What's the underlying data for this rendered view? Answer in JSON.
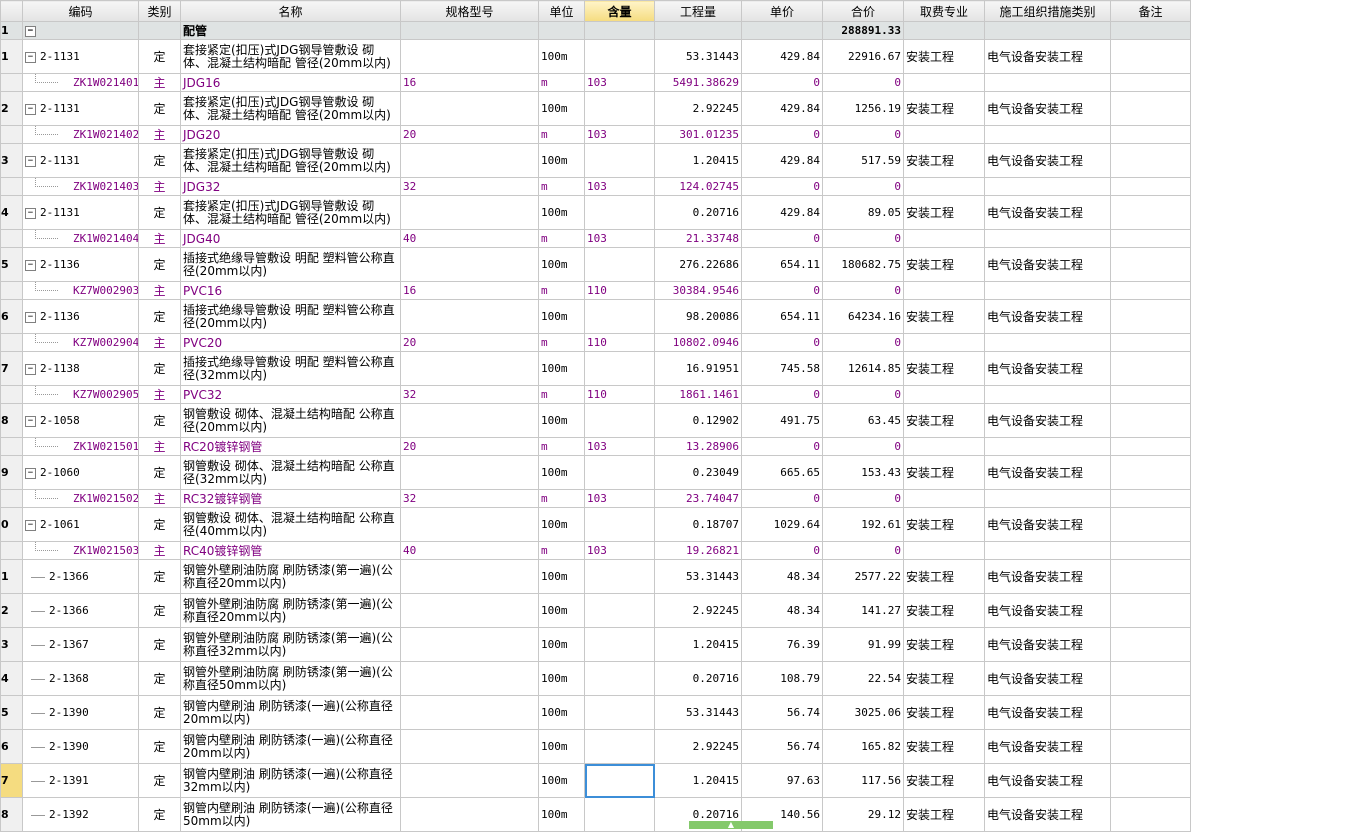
{
  "headers": [
    "编码",
    "类别",
    "名称",
    "规格型号",
    "单位",
    "含量",
    "工程量",
    "单价",
    "合价",
    "取费专业",
    "施工组织措施类别",
    "备注"
  ],
  "group": {
    "rownum": "1",
    "toggle": "−",
    "name": "配管",
    "total": "288891.33"
  },
  "rows": [
    {
      "type": "qd",
      "rn": "1",
      "toggle": "−",
      "code": "2-1131",
      "cat": "定",
      "name": "套接紧定(扣压)式JDG钢导管敷设 砌体、混凝土结构暗配 管径(20mm以内)",
      "spec": "",
      "unit": "100m",
      "content": "",
      "qty": "53.31443",
      "price": "429.84",
      "total": "22916.67",
      "fee": "安装工程",
      "measure": "电气设备安装工程",
      "note": ""
    },
    {
      "type": "sub",
      "rn": "",
      "code": "ZK1W021401",
      "cat": "主",
      "name": "JDG16",
      "spec": "16",
      "unit": "m",
      "content": "103",
      "qty": "5491.38629",
      "price": "0",
      "total": "0",
      "fee": "",
      "measure": "",
      "note": ""
    },
    {
      "type": "qd",
      "rn": "2",
      "toggle": "−",
      "code": "2-1131",
      "cat": "定",
      "name": "套接紧定(扣压)式JDG钢导管敷设 砌体、混凝土结构暗配 管径(20mm以内)",
      "spec": "",
      "unit": "100m",
      "content": "",
      "qty": "2.92245",
      "price": "429.84",
      "total": "1256.19",
      "fee": "安装工程",
      "measure": "电气设备安装工程",
      "note": ""
    },
    {
      "type": "sub",
      "rn": "",
      "code": "ZK1W021402",
      "cat": "主",
      "name": "JDG20",
      "spec": "20",
      "unit": "m",
      "content": "103",
      "qty": "301.01235",
      "price": "0",
      "total": "0",
      "fee": "",
      "measure": "",
      "note": ""
    },
    {
      "type": "qd",
      "rn": "3",
      "toggle": "−",
      "code": "2-1131",
      "cat": "定",
      "name": "套接紧定(扣压)式JDG钢导管敷设 砌体、混凝土结构暗配 管径(20mm以内)",
      "spec": "",
      "unit": "100m",
      "content": "",
      "qty": "1.20415",
      "price": "429.84",
      "total": "517.59",
      "fee": "安装工程",
      "measure": "电气设备安装工程",
      "note": ""
    },
    {
      "type": "sub",
      "rn": "",
      "code": "ZK1W021403",
      "cat": "主",
      "name": "JDG32",
      "spec": "32",
      "unit": "m",
      "content": "103",
      "qty": "124.02745",
      "price": "0",
      "total": "0",
      "fee": "",
      "measure": "",
      "note": ""
    },
    {
      "type": "qd",
      "rn": "4",
      "toggle": "−",
      "code": "2-1131",
      "cat": "定",
      "name": "套接紧定(扣压)式JDG钢导管敷设 砌体、混凝土结构暗配 管径(20mm以内)",
      "spec": "",
      "unit": "100m",
      "content": "",
      "qty": "0.20716",
      "price": "429.84",
      "total": "89.05",
      "fee": "安装工程",
      "measure": "电气设备安装工程",
      "note": ""
    },
    {
      "type": "sub",
      "rn": "",
      "code": "ZK1W021404",
      "cat": "主",
      "name": "JDG40",
      "spec": "40",
      "unit": "m",
      "content": "103",
      "qty": "21.33748",
      "price": "0",
      "total": "0",
      "fee": "",
      "measure": "",
      "note": ""
    },
    {
      "type": "qd",
      "rn": "5",
      "toggle": "−",
      "code": "2-1136",
      "cat": "定",
      "name": "插接式绝缘导管敷设 明配 塑料管公称直径(20mm以内)",
      "spec": "",
      "unit": "100m",
      "content": "",
      "qty": "276.22686",
      "price": "654.11",
      "total": "180682.75",
      "fee": "安装工程",
      "measure": "电气设备安装工程",
      "note": ""
    },
    {
      "type": "sub",
      "rn": "",
      "code": "KZ7W002903",
      "cat": "主",
      "name": "PVC16",
      "spec": "16",
      "unit": "m",
      "content": "110",
      "qty": "30384.9546",
      "price": "0",
      "total": "0",
      "fee": "",
      "measure": "",
      "note": ""
    },
    {
      "type": "qd",
      "rn": "6",
      "toggle": "−",
      "code": "2-1136",
      "cat": "定",
      "name": "插接式绝缘导管敷设 明配 塑料管公称直径(20mm以内)",
      "spec": "",
      "unit": "100m",
      "content": "",
      "qty": "98.20086",
      "price": "654.11",
      "total": "64234.16",
      "fee": "安装工程",
      "measure": "电气设备安装工程",
      "note": ""
    },
    {
      "type": "sub",
      "rn": "",
      "code": "KZ7W002904",
      "cat": "主",
      "name": "PVC20",
      "spec": "20",
      "unit": "m",
      "content": "110",
      "qty": "10802.0946",
      "price": "0",
      "total": "0",
      "fee": "",
      "measure": "",
      "note": ""
    },
    {
      "type": "qd",
      "rn": "7",
      "toggle": "−",
      "code": "2-1138",
      "cat": "定",
      "name": "插接式绝缘导管敷设 明配 塑料管公称直径(32mm以内)",
      "spec": "",
      "unit": "100m",
      "content": "",
      "qty": "16.91951",
      "price": "745.58",
      "total": "12614.85",
      "fee": "安装工程",
      "measure": "电气设备安装工程",
      "note": ""
    },
    {
      "type": "sub",
      "rn": "",
      "code": "KZ7W002905",
      "cat": "主",
      "name": "PVC32",
      "spec": "32",
      "unit": "m",
      "content": "110",
      "qty": "1861.1461",
      "price": "0",
      "total": "0",
      "fee": "",
      "measure": "",
      "note": ""
    },
    {
      "type": "qd",
      "rn": "8",
      "toggle": "−",
      "code": "2-1058",
      "cat": "定",
      "name": "钢管敷设 砌体、混凝土结构暗配 公称直径(20mm以内)",
      "spec": "",
      "unit": "100m",
      "content": "",
      "qty": "0.12902",
      "price": "491.75",
      "total": "63.45",
      "fee": "安装工程",
      "measure": "电气设备安装工程",
      "note": ""
    },
    {
      "type": "sub",
      "rn": "",
      "code": "ZK1W021501",
      "cat": "主",
      "name": "RC20镀锌钢管",
      "spec": "20",
      "unit": "m",
      "content": "103",
      "qty": "13.28906",
      "price": "0",
      "total": "0",
      "fee": "",
      "measure": "",
      "note": ""
    },
    {
      "type": "qd",
      "rn": "9",
      "toggle": "−",
      "code": "2-1060",
      "cat": "定",
      "name": "钢管敷设 砌体、混凝土结构暗配 公称直径(32mm以内)",
      "spec": "",
      "unit": "100m",
      "content": "",
      "qty": "0.23049",
      "price": "665.65",
      "total": "153.43",
      "fee": "安装工程",
      "measure": "电气设备安装工程",
      "note": ""
    },
    {
      "type": "sub",
      "rn": "",
      "code": "ZK1W021502",
      "cat": "主",
      "name": "RC32镀锌钢管",
      "spec": "32",
      "unit": "m",
      "content": "103",
      "qty": "23.74047",
      "price": "0",
      "total": "0",
      "fee": "",
      "measure": "",
      "note": ""
    },
    {
      "type": "qd",
      "rn": "0",
      "toggle": "−",
      "code": "2-1061",
      "cat": "定",
      "name": "钢管敷设 砌体、混凝土结构暗配 公称直径(40mm以内)",
      "spec": "",
      "unit": "100m",
      "content": "",
      "qty": "0.18707",
      "price": "1029.64",
      "total": "192.61",
      "fee": "安装工程",
      "measure": "电气设备安装工程",
      "note": ""
    },
    {
      "type": "sub",
      "rn": "",
      "code": "ZK1W021503",
      "cat": "主",
      "name": "RC40镀锌钢管",
      "spec": "40",
      "unit": "m",
      "content": "103",
      "qty": "19.26821",
      "price": "0",
      "total": "0",
      "fee": "",
      "measure": "",
      "note": ""
    },
    {
      "type": "qd",
      "rn": "1",
      "toggle": "",
      "code": "2-1366",
      "cat": "定",
      "name": "钢管外壁刷油防腐 刷防锈漆(第一遍)(公称直径20mm以内)",
      "spec": "",
      "unit": "100m",
      "content": "",
      "qty": "53.31443",
      "price": "48.34",
      "total": "2577.22",
      "fee": "安装工程",
      "measure": "电气设备安装工程",
      "note": ""
    },
    {
      "type": "qd",
      "rn": "2",
      "toggle": "",
      "code": "2-1366",
      "cat": "定",
      "name": "钢管外壁刷油防腐 刷防锈漆(第一遍)(公称直径20mm以内)",
      "spec": "",
      "unit": "100m",
      "content": "",
      "qty": "2.92245",
      "price": "48.34",
      "total": "141.27",
      "fee": "安装工程",
      "measure": "电气设备安装工程",
      "note": ""
    },
    {
      "type": "qd",
      "rn": "3",
      "toggle": "",
      "code": "2-1367",
      "cat": "定",
      "name": "钢管外壁刷油防腐 刷防锈漆(第一遍)(公称直径32mm以内)",
      "spec": "",
      "unit": "100m",
      "content": "",
      "qty": "1.20415",
      "price": "76.39",
      "total": "91.99",
      "fee": "安装工程",
      "measure": "电气设备安装工程",
      "note": ""
    },
    {
      "type": "qd",
      "rn": "4",
      "toggle": "",
      "code": "2-1368",
      "cat": "定",
      "name": "钢管外壁刷油防腐 刷防锈漆(第一遍)(公称直径50mm以内)",
      "spec": "",
      "unit": "100m",
      "content": "",
      "qty": "0.20716",
      "price": "108.79",
      "total": "22.54",
      "fee": "安装工程",
      "measure": "电气设备安装工程",
      "note": ""
    },
    {
      "type": "qd",
      "rn": "5",
      "toggle": "",
      "code": "2-1390",
      "cat": "定",
      "name": "钢管内壁刷油 刷防锈漆(一遍)(公称直径20mm以内)",
      "spec": "",
      "unit": "100m",
      "content": "",
      "qty": "53.31443",
      "price": "56.74",
      "total": "3025.06",
      "fee": "安装工程",
      "measure": "电气设备安装工程",
      "note": ""
    },
    {
      "type": "qd",
      "rn": "6",
      "toggle": "",
      "code": "2-1390",
      "cat": "定",
      "name": "钢管内壁刷油 刷防锈漆(一遍)(公称直径20mm以内)",
      "spec": "",
      "unit": "100m",
      "content": "",
      "qty": "2.92245",
      "price": "56.74",
      "total": "165.82",
      "fee": "安装工程",
      "measure": "电气设备安装工程",
      "note": ""
    },
    {
      "type": "qd",
      "rn": "7",
      "toggle": "",
      "code": "2-1391",
      "cat": "定",
      "name": "钢管内壁刷油 刷防锈漆(一遍)(公称直径32mm以内)",
      "spec": "",
      "unit": "100m",
      "content": "",
      "qty": "1.20415",
      "price": "97.63",
      "total": "117.56",
      "fee": "安装工程",
      "measure": "电气设备安装工程",
      "note": "",
      "active": true
    },
    {
      "type": "qd",
      "rn": "8",
      "toggle": "",
      "code": "2-1392",
      "cat": "定",
      "name": "钢管内壁刷油 刷防锈漆(一遍)(公称直径50mm以内)",
      "spec": "",
      "unit": "100m",
      "content": "",
      "qty": "0.20716",
      "price": "140.56",
      "total": "29.12",
      "fee": "安装工程",
      "measure": "电气设备安装工程",
      "note": ""
    }
  ],
  "colors": {
    "subrow_text": "#800080",
    "header_selected": "#f5dc80",
    "active_cell_border": "#3c8ed8",
    "bottom_tab": "#84c96b"
  },
  "icons": {
    "toggle": "collapse-box-icon",
    "bottom_tab": "chevron-up-icon"
  }
}
